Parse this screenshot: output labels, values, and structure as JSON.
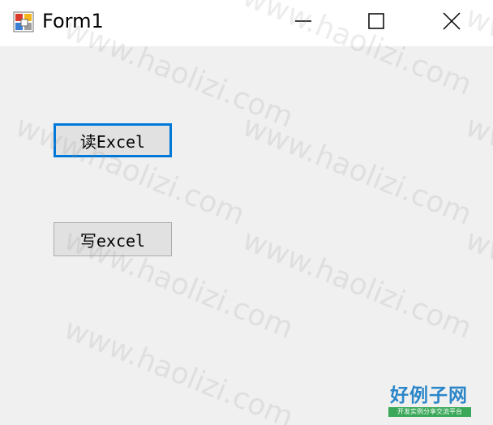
{
  "window": {
    "title": "Form1"
  },
  "buttons": {
    "read_label": "读Excel",
    "write_label": "写excel"
  },
  "watermark": {
    "text": "www.haolizi.com"
  },
  "logo": {
    "main_text": "好例子网",
    "sub_text": "开发实例分享交流平台"
  },
  "colors": {
    "focus_border": "#0078d7",
    "client_background": "#f0f0f0",
    "button_face": "#e1e1e1"
  },
  "icons": {
    "app": "form-app-icon",
    "minimize": "minimize-icon",
    "maximize": "maximize-icon",
    "close": "close-icon"
  }
}
